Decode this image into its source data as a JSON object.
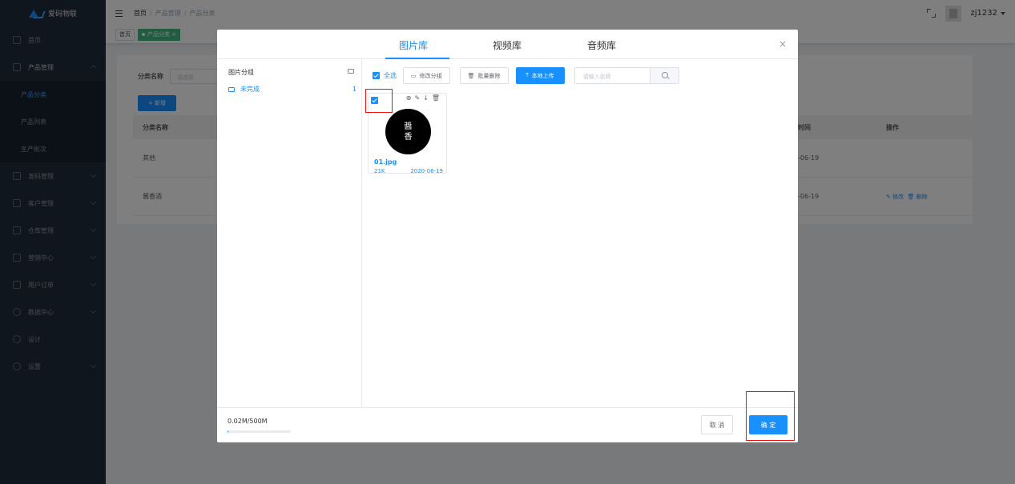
{
  "app": {
    "logo_text": "爱码物联"
  },
  "sidebar": {
    "items": [
      {
        "label": "首页"
      },
      {
        "label": "产品管理"
      },
      {
        "label": "发码管理"
      },
      {
        "label": "客户管理"
      },
      {
        "label": "仓库管理"
      },
      {
        "label": "营销中心"
      },
      {
        "label": "用户订单"
      },
      {
        "label": "数据中心"
      },
      {
        "label": "设计"
      },
      {
        "label": "设置"
      }
    ],
    "submenu": [
      {
        "label": "产品分类"
      },
      {
        "label": "产品列表"
      },
      {
        "label": "生产批次"
      }
    ]
  },
  "header": {
    "breadcrumb": [
      "首页",
      "产品管理",
      "产品分类"
    ],
    "separator": "/",
    "user_name": "zj1232"
  },
  "tags": {
    "home": "首页",
    "active": "产品分类",
    "close": "×"
  },
  "page": {
    "filter_label": "分类名称",
    "filter_placeholder": "请选择",
    "add_button": "+ 新增",
    "table_headers": {
      "name": "分类名称",
      "time": "时间",
      "ops": "操作"
    },
    "rows": [
      {
        "name": "其他",
        "time": "-06-19",
        "ops": ""
      },
      {
        "name": "酱香酒",
        "time": "-06-19",
        "edit": "修改",
        "delete": "删除"
      }
    ]
  },
  "modal": {
    "tabs": [
      "图片库",
      "视频库",
      "音频库"
    ],
    "active_tab": 0,
    "close": "×",
    "left": {
      "title": "图片分组",
      "groups": [
        {
          "label": "未完成",
          "count": "1"
        }
      ]
    },
    "toolbar": {
      "select_all": "全选",
      "modify_group": "修改分组",
      "batch_delete": "批量删除",
      "upload": "本地上传",
      "search_placeholder": "请输入名称"
    },
    "files": [
      {
        "name": "01.jpg",
        "size": "21K",
        "date": "2020-06-19",
        "thumb_text": [
          "醬",
          "香"
        ],
        "selected": true
      }
    ],
    "card_actions": [
      "⊕",
      "✎",
      "↓",
      "🗑"
    ],
    "footer": {
      "quota": "0.02M/500M",
      "quota_fraction": 4e-05,
      "cancel": "取 消",
      "ok": "确 定"
    }
  },
  "colors": {
    "accent": "#1890ff",
    "sidebar": "#1f2d3d",
    "highlight": "#ee1111",
    "tag_active": "#42b983"
  }
}
